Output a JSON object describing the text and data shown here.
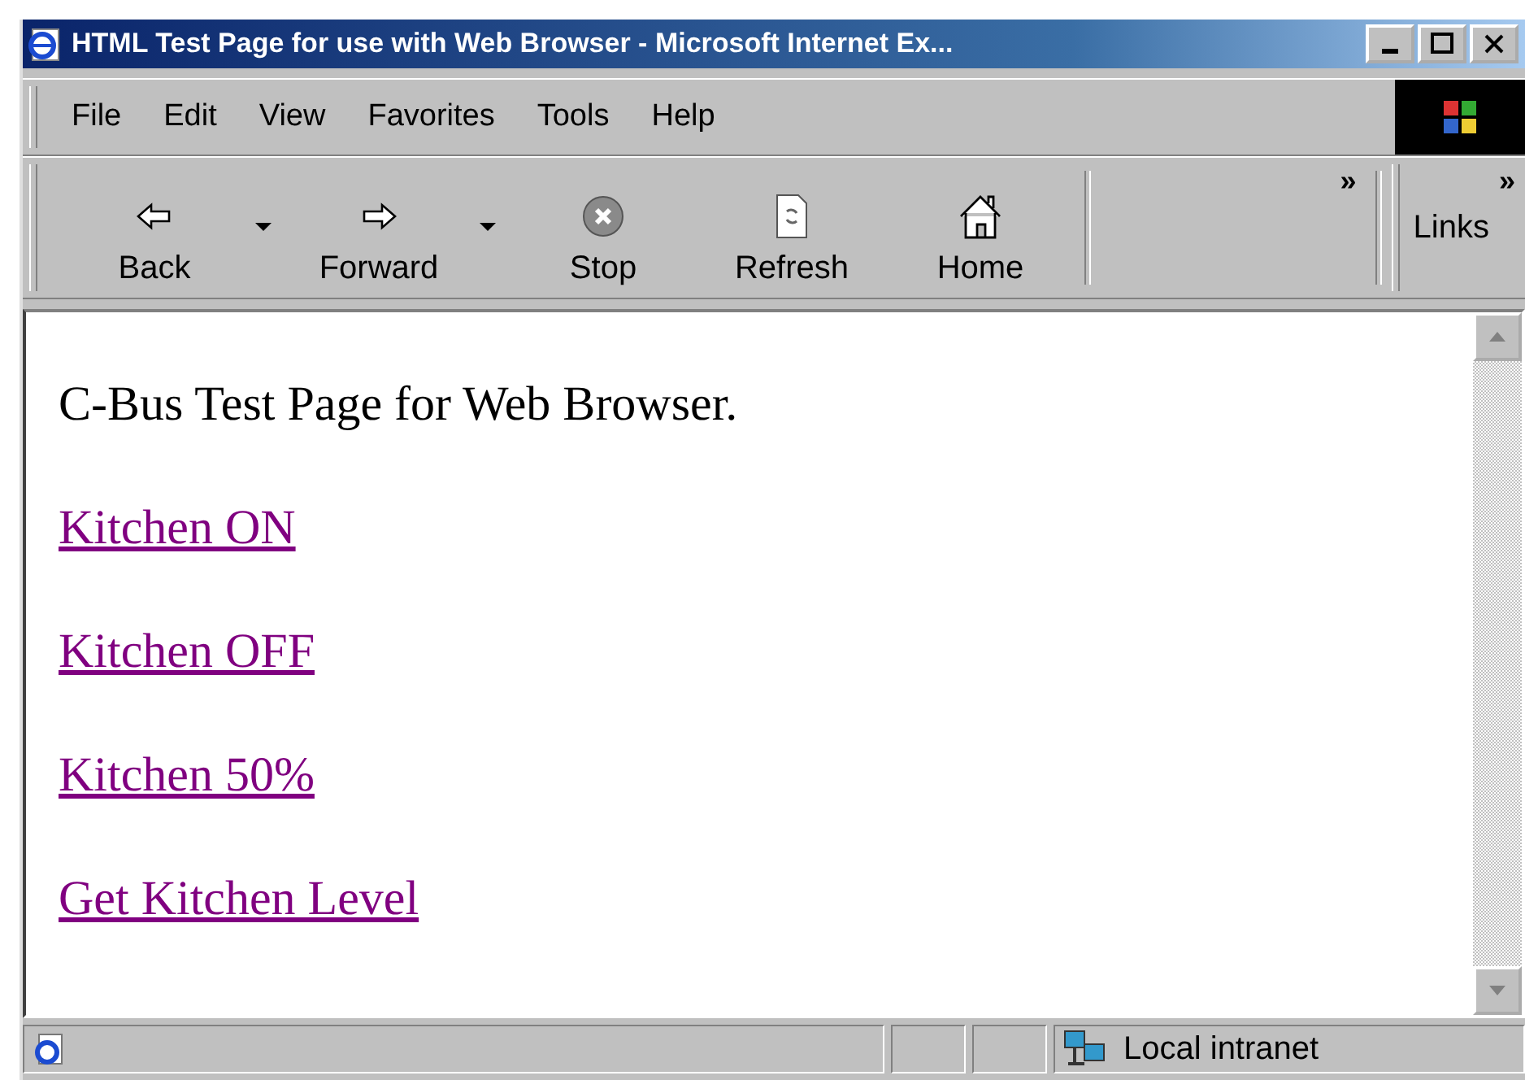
{
  "window": {
    "title": "HTML Test Page for use with Web Browser - Microsoft Internet Ex..."
  },
  "menu": [
    {
      "label": "File"
    },
    {
      "label": "Edit"
    },
    {
      "label": "View"
    },
    {
      "label": "Favorites"
    },
    {
      "label": "Tools"
    },
    {
      "label": "Help"
    }
  ],
  "toolbar": {
    "buttons": [
      {
        "label": "Back",
        "kind": "back",
        "dropdown": true
      },
      {
        "label": "Forward",
        "kind": "forward",
        "dropdown": true
      },
      {
        "label": "Stop",
        "kind": "stop",
        "dropdown": false
      },
      {
        "label": "Refresh",
        "kind": "refresh",
        "dropdown": false
      },
      {
        "label": "Home",
        "kind": "home",
        "dropdown": false
      }
    ],
    "chevron": "»",
    "links_label": "Links",
    "links_chevron": "»"
  },
  "page": {
    "heading": "C-Bus Test Page for Web Browser.",
    "links": [
      {
        "label": "Kitchen ON",
        "visited": true
      },
      {
        "label": "Kitchen OFF",
        "visited": true
      },
      {
        "label": "Kitchen 50%",
        "visited": true
      },
      {
        "label": "Get Kitchen Level",
        "visited": true
      }
    ]
  },
  "status_bar": {
    "zone": "Local intranet"
  }
}
